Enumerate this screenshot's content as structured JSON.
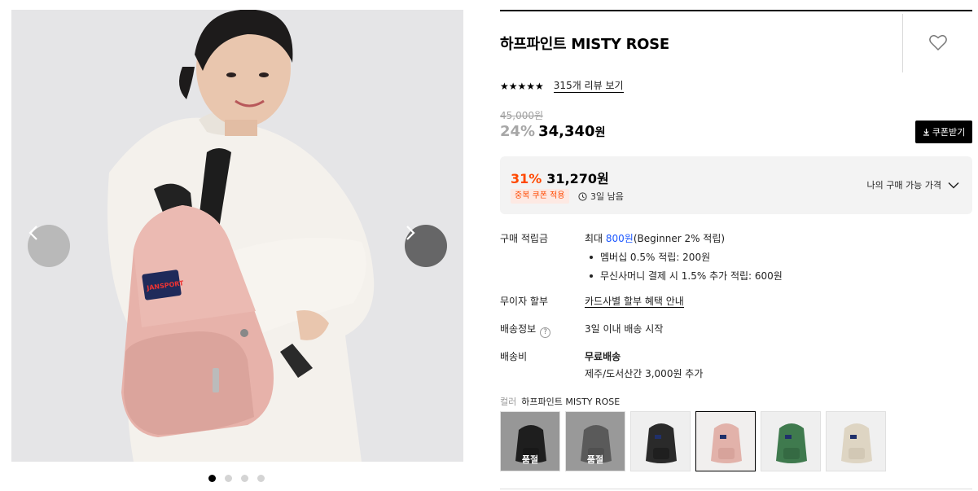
{
  "gallery": {
    "prev_icon": "chevron-left-icon",
    "next_icon": "chevron-right-icon",
    "bag_brand": "JANSPORT",
    "dots_count": 4,
    "active_dot": 0
  },
  "product": {
    "title": "하프파인트 MISTY ROSE",
    "heart_icon": "heart-outline-icon",
    "stars": "★★★★★",
    "reviews_link": "315개 리뷰 보기",
    "original_price": "45,000원",
    "discount_rate": "24%",
    "price": "34,340",
    "price_unit": "원",
    "coupon_button": "쿠폰받기"
  },
  "my_price": {
    "discount_rate": "31%",
    "price": "31,270원",
    "badge": "중복 쿠폰 적용",
    "remaining": "3일 남음",
    "label": "나의 구매 가능 가격"
  },
  "details": {
    "points_label": "구매 적립금",
    "points_prefix": "최대 ",
    "points_amount": "800원",
    "points_suffix": "(Beginner 2% 적립)",
    "points_bullet_1": "멤버십 0.5% 적립: 200원",
    "points_bullet_2": "무신사머니 결제 시 1.5% 추가 적립: 600원",
    "installment_label": "무이자 할부",
    "installment_link": "카드사별 할부 혜택 안내",
    "shipping_info_label": "배송정보",
    "shipping_info_value": "3일 이내 배송 시작",
    "shipping_fee_label": "배송비",
    "shipping_fee_value": "무료배송",
    "shipping_fee_extra": "제주/도서산간 3,000원 추가"
  },
  "colors": {
    "label": "컬러",
    "selected": "하프파인트 MISTY ROSE",
    "sold_out_text": "품절",
    "swatches": [
      {
        "color": "#2f2f2f",
        "sold_out": true,
        "selected": false
      },
      {
        "color": "#8a8a8a",
        "sold_out": true,
        "selected": false
      },
      {
        "color": "#2a2a2a",
        "sold_out": false,
        "selected": false
      },
      {
        "color": "#e2b2aa",
        "sold_out": false,
        "selected": true
      },
      {
        "color": "#3f7a4e",
        "sold_out": false,
        "selected": false
      },
      {
        "color": "#ded5c3",
        "sold_out": false,
        "selected": false
      }
    ]
  },
  "theme": {
    "accent": "#ff4800",
    "link_blue": "#1a56ff"
  }
}
